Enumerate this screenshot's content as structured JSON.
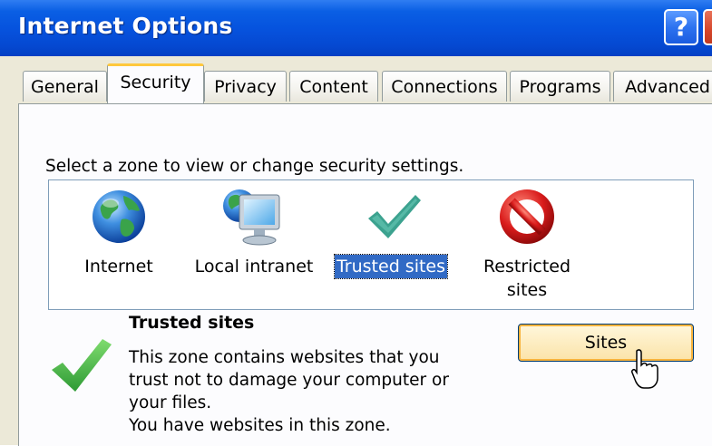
{
  "window": {
    "title": "Internet Options",
    "help_label": "?"
  },
  "tabs": [
    {
      "label": "General"
    },
    {
      "label": "Security"
    },
    {
      "label": "Privacy"
    },
    {
      "label": "Content"
    },
    {
      "label": "Connections"
    },
    {
      "label": "Programs"
    },
    {
      "label": "Advanced"
    }
  ],
  "active_tab": "Security",
  "security": {
    "prompt": "Select a zone to view or change security settings.",
    "zones": [
      {
        "label": "Internet",
        "icon": "globe-icon"
      },
      {
        "label": "Local intranet",
        "icon": "intranet-monitor-icon"
      },
      {
        "label": "Trusted sites",
        "icon": "checkmark-icon",
        "selected": true
      },
      {
        "label_line1": "Restricted",
        "label_line2": "sites",
        "icon": "restricted-icon"
      }
    ],
    "selected_zone": {
      "title": "Trusted sites",
      "description_lines": [
        "This zone contains websites that you",
        "trust not to damage your computer or",
        "your files.",
        "You have websites in this zone."
      ],
      "sites_button": "Sites"
    }
  },
  "colors": {
    "titlebar": "#0653de",
    "selection": "#316ac5",
    "active_tab_accent": "#ffc83c",
    "checkmark_teal": "#3ca28f",
    "checkmark_green": "#46b84a",
    "restricted_red": "#d91b1b"
  }
}
